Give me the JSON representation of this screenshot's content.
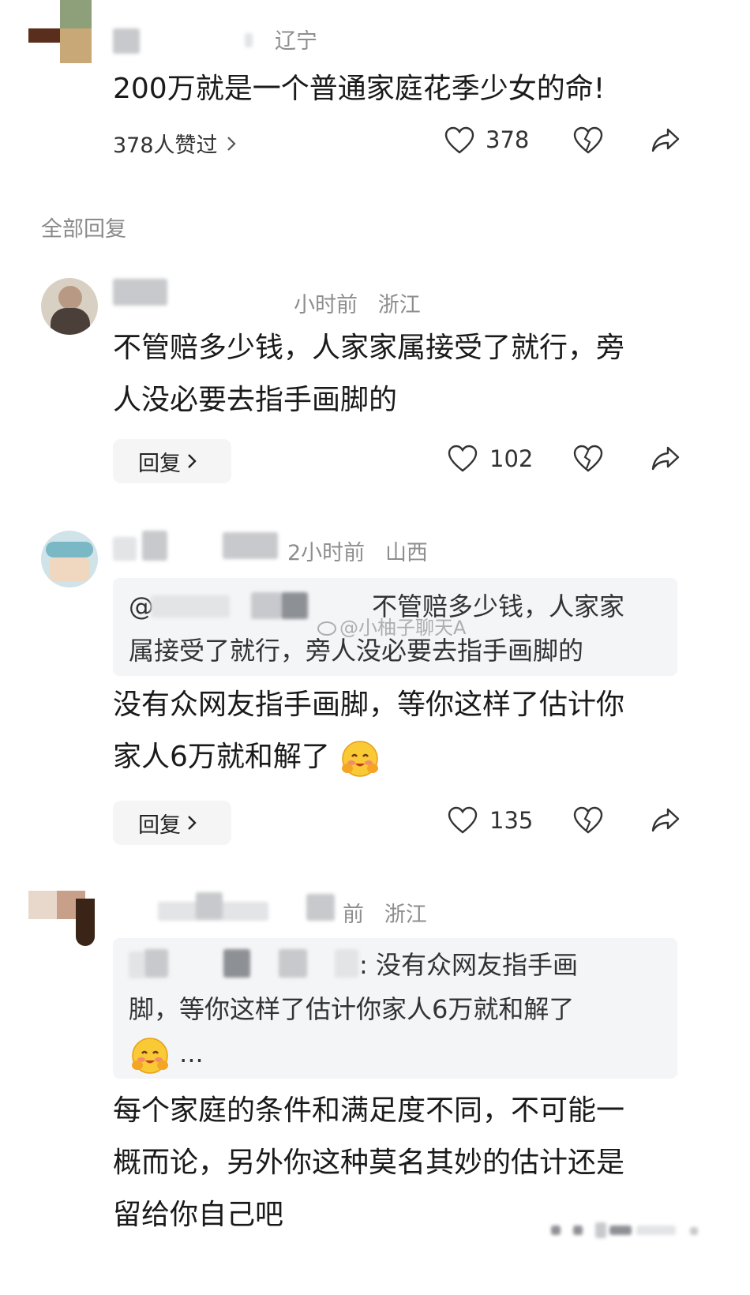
{
  "top_comment": {
    "location": "辽宁",
    "text": "200万就是一个普通家庭花季少女的命!",
    "liked_by": "378人赞过",
    "likes": "378"
  },
  "all_replies_label": "全部回复",
  "replies": [
    {
      "meta": "小时前",
      "location": "浙江",
      "text_line1": "不管赔多少钱，人家家属接受了就行，旁",
      "text_line2": "人没必要去指手画脚的",
      "reply_label": "回复",
      "likes": "102"
    },
    {
      "meta": "2小时前",
      "location": "山西",
      "quote_prefix": "@",
      "quote_line1": "不管赔多少钱，人家家",
      "quote_line2": "属接受了就行，旁人没必要去指手画脚的",
      "text_line1": "没有众网友指手画脚，等你这样了估计你",
      "text_line2": "家人6万就和解了",
      "reply_label": "回复",
      "likes": "135"
    },
    {
      "meta": "前",
      "location": "浙江",
      "quote_line1": "没有众网友指手画",
      "quote_line2": "脚，等你这样了估计你家人6万就和解了",
      "quote_ellipsis": "...",
      "text_line1": "每个家庭的条件和满足度不同，不可能一",
      "text_line2": "概而论，另外你这种莫名其妙的估计还是",
      "text_line3": "留给你自己吧"
    }
  ],
  "watermark": "@小柚子聊天A",
  "icons": {
    "like": "heart-outline-icon",
    "dislike": "broken-heart-icon",
    "share": "share-arrow-icon",
    "chevron": "chevron-right-icon"
  }
}
